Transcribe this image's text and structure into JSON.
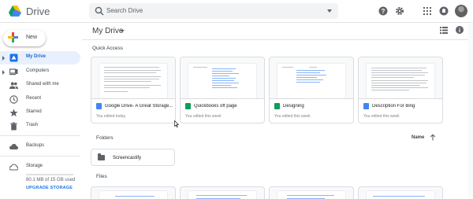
{
  "app": {
    "title": "Drive"
  },
  "search": {
    "placeholder": "Search Drive"
  },
  "sidebar": {
    "new_label": "New",
    "items": [
      {
        "label": "My Drive",
        "icon": "drive-icon",
        "active": true
      },
      {
        "label": "Computers",
        "icon": "computer-icon"
      },
      {
        "label": "Shared with me",
        "icon": "people-icon"
      },
      {
        "label": "Recent",
        "icon": "clock-icon"
      },
      {
        "label": "Starred",
        "icon": "star-icon"
      },
      {
        "label": "Trash",
        "icon": "trash-icon"
      },
      {
        "label": "Backups",
        "icon": "cloud-icon"
      },
      {
        "label": "Storage",
        "icon": "cloud-storage-icon"
      }
    ],
    "storage_used": "80.1 MB of 15 GB used",
    "upgrade_label": "UPGRADE STORAGE"
  },
  "main": {
    "breadcrumb": "My Drive",
    "quick_access_label": "Quick Access",
    "quick_access": [
      {
        "name": "Google Drive- A Great Storage...",
        "type": "docs",
        "sub": "You edited today"
      },
      {
        "name": "Quickbooks off page",
        "type": "sheets",
        "sub": "You edited this week"
      },
      {
        "name": "Designing",
        "type": "sheets",
        "sub": "You edited this week"
      },
      {
        "name": "Description For Bing",
        "type": "docs",
        "sub": "You edited this week"
      }
    ],
    "folders_label": "Folders",
    "sort_label": "Name",
    "folders": [
      {
        "name": "Screencastify"
      }
    ],
    "files_label": "Files"
  },
  "colors": {
    "accent": "#1a73e8",
    "active_bg": "#e8f0fe",
    "docs": "#4285f4",
    "sheets": "#0f9d58",
    "border": "#dadce0"
  }
}
